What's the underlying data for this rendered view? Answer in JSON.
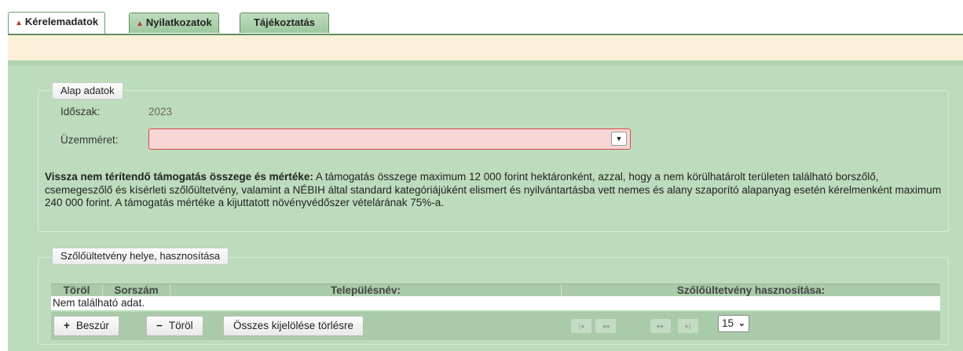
{
  "tabs": [
    {
      "label": "Kérelemadatok",
      "warn": "▲"
    },
    {
      "label": "Nyilatkozatok",
      "warn": "▲"
    },
    {
      "label": "Tájékoztatás"
    }
  ],
  "basic": {
    "legend": "Alap adatok",
    "period_label": "Időszak:",
    "period_value": "2023",
    "size_label": "Üzemméret:",
    "size_value": "",
    "info_bold": "Vissza nem térítendő támogatás összege és mértéke:",
    "info_text": " A támogatás összege maximum 12 000 forint hektáronként, azzal, hogy a nem körülhatárolt területen található borszőlő, csemegeszőlő és kísérleti szőlőültetvény, valamint a NÉBIH által standard kategóriájúként elismert és nyilvántartásba vett nemes és alany szaporító alapanyag esetén kérelmenként maximum 240 000 forint. A támogatás mértéke a kijuttatott növényvédőszer vételárának 75%-a."
  },
  "grid": {
    "legend": "Szőlőültetvény helye, hasznosítása",
    "columns": [
      "Töröl",
      "Sorszám",
      "Településnév:",
      "Szőlőültetvény hasznosítása:"
    ],
    "empty_text": "Nem található adat.",
    "insert_label": "Beszúr",
    "insert_symbol": "+",
    "delete_label": "Töröl",
    "delete_symbol": "−",
    "clear_selection_label": "Összes kijelölése törlésre",
    "pager": {
      "first": "|◂",
      "prev": "◂◂",
      "next": "▸▸",
      "last": "▸|"
    },
    "page_size": "15"
  },
  "colors": {
    "panel_green": "#bcdcbc",
    "header_green": "#a9cba9",
    "warn_red": "#c0392b",
    "select_error_bg": "#f8d6d6",
    "band_yellow": "#fcf0d8"
  }
}
